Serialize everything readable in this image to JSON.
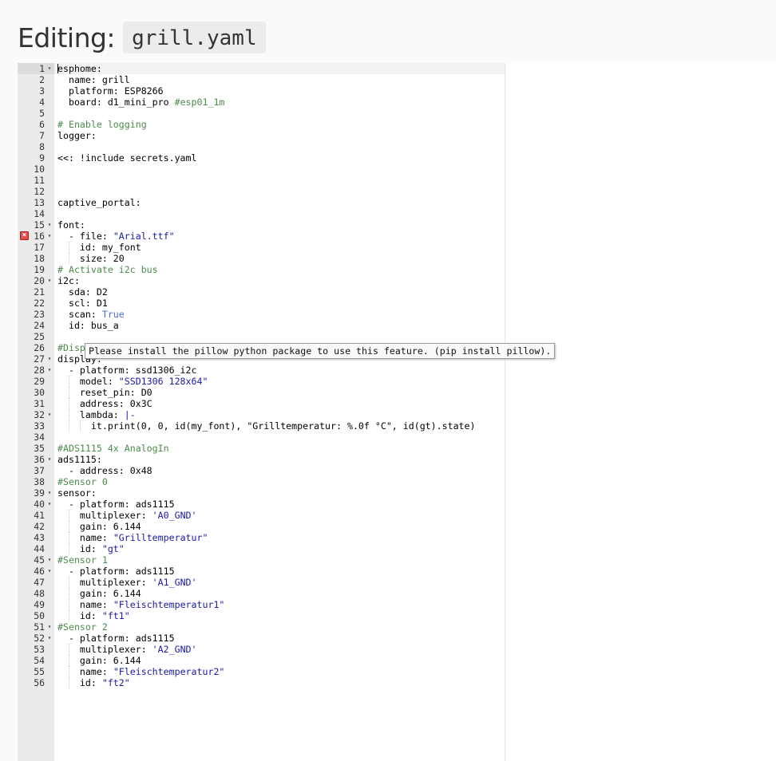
{
  "header": {
    "label": "Editing:",
    "filename": "grill.yaml"
  },
  "tooltip": "Please install the pillow python package to use this feature. (pip install pillow).",
  "lines": [
    {
      "n": "1",
      "fold": true,
      "segs": [
        [
          "k",
          "esphome:"
        ]
      ]
    },
    {
      "n": "2",
      "segs": [
        [
          "k",
          "  name: grill"
        ]
      ]
    },
    {
      "n": "3",
      "segs": [
        [
          "k",
          "  platform: ESP8266"
        ]
      ]
    },
    {
      "n": "4",
      "segs": [
        [
          "k",
          "  board: d1_mini_pro "
        ],
        [
          "c",
          "#esp01_1m"
        ]
      ]
    },
    {
      "n": "5",
      "segs": []
    },
    {
      "n": "6",
      "segs": [
        [
          "c",
          "# Enable logging"
        ]
      ]
    },
    {
      "n": "7",
      "segs": [
        [
          "k",
          "logger:"
        ]
      ]
    },
    {
      "n": "8",
      "segs": []
    },
    {
      "n": "9",
      "segs": [
        [
          "k",
          "<<: !include secrets.yaml"
        ]
      ]
    },
    {
      "n": "10",
      "segs": []
    },
    {
      "n": "11",
      "segs": []
    },
    {
      "n": "12",
      "segs": []
    },
    {
      "n": "13",
      "segs": [
        [
          "k",
          "captive_portal:"
        ]
      ]
    },
    {
      "n": "14",
      "segs": []
    },
    {
      "n": "15",
      "fold": true,
      "segs": [
        [
          "k",
          "font:"
        ]
      ]
    },
    {
      "n": "16",
      "fold": true,
      "error": true,
      "segs": [
        [
          "k",
          "  - file: "
        ],
        [
          "s",
          "\"Arial.ttf\""
        ]
      ]
    },
    {
      "n": "17",
      "segs": [
        [
          "k",
          "    id: my_font"
        ]
      ]
    },
    {
      "n": "18",
      "segs": [
        [
          "k",
          "    size: 20"
        ]
      ]
    },
    {
      "n": "19",
      "segs": [
        [
          "c",
          "# Activate i2c bus"
        ]
      ]
    },
    {
      "n": "20",
      "fold": true,
      "segs": [
        [
          "k",
          "i2c:"
        ]
      ]
    },
    {
      "n": "21",
      "segs": [
        [
          "k",
          "  sda: D2"
        ]
      ]
    },
    {
      "n": "22",
      "segs": [
        [
          "k",
          "  scl: D1"
        ]
      ]
    },
    {
      "n": "23",
      "segs": [
        [
          "k",
          "  scan: "
        ],
        [
          "b",
          "True"
        ]
      ]
    },
    {
      "n": "24",
      "segs": [
        [
          "k",
          "  id: bus_a"
        ]
      ]
    },
    {
      "n": "25",
      "segs": []
    },
    {
      "n": "26",
      "segs": [
        [
          "c",
          "#Disp"
        ]
      ]
    },
    {
      "n": "27",
      "fold": true,
      "segs": [
        [
          "k",
          "display:"
        ]
      ]
    },
    {
      "n": "28",
      "fold": true,
      "segs": [
        [
          "k",
          "  - platform: ssd1306_i2c"
        ]
      ]
    },
    {
      "n": "29",
      "segs": [
        [
          "k",
          "    model: "
        ],
        [
          "s",
          "\"SSD1306 128x64\""
        ]
      ]
    },
    {
      "n": "30",
      "segs": [
        [
          "k",
          "    reset_pin: D0"
        ]
      ]
    },
    {
      "n": "31",
      "segs": [
        [
          "k",
          "    address: 0x3C"
        ]
      ]
    },
    {
      "n": "32",
      "fold": true,
      "segs": [
        [
          "k",
          "    lambda: "
        ],
        [
          "s",
          "|-"
        ]
      ]
    },
    {
      "n": "33",
      "segs": [
        [
          "k",
          "      it.print(0, 0, id(my_font), \"Grilltemperatur: %.0f °C\", id(gt).state)"
        ]
      ]
    },
    {
      "n": "34",
      "segs": []
    },
    {
      "n": "35",
      "segs": [
        [
          "c",
          "#ADS1115 4x AnalogIn"
        ]
      ]
    },
    {
      "n": "36",
      "fold": true,
      "segs": [
        [
          "k",
          "ads1115:"
        ]
      ]
    },
    {
      "n": "37",
      "segs": [
        [
          "k",
          "  - address: 0x48"
        ]
      ]
    },
    {
      "n": "38",
      "segs": [
        [
          "c",
          "#Sensor 0"
        ]
      ]
    },
    {
      "n": "39",
      "fold": true,
      "segs": [
        [
          "k",
          "sensor:"
        ]
      ]
    },
    {
      "n": "40",
      "fold": true,
      "segs": [
        [
          "k",
          "  - platform: ads1115"
        ]
      ]
    },
    {
      "n": "41",
      "segs": [
        [
          "k",
          "    multiplexer: "
        ],
        [
          "s",
          "'A0_GND'"
        ]
      ]
    },
    {
      "n": "42",
      "segs": [
        [
          "k",
          "    gain: 6.144"
        ]
      ]
    },
    {
      "n": "43",
      "segs": [
        [
          "k",
          "    name: "
        ],
        [
          "s",
          "\"Grilltemperatur\""
        ]
      ]
    },
    {
      "n": "44",
      "segs": [
        [
          "k",
          "    id: "
        ],
        [
          "s",
          "\"gt\""
        ]
      ]
    },
    {
      "n": "45",
      "fold": true,
      "segs": [
        [
          "c",
          "#Sensor 1"
        ]
      ]
    },
    {
      "n": "46",
      "fold": true,
      "segs": [
        [
          "k",
          "  - platform: ads1115"
        ]
      ]
    },
    {
      "n": "47",
      "segs": [
        [
          "k",
          "    multiplexer: "
        ],
        [
          "s",
          "'A1_GND'"
        ]
      ]
    },
    {
      "n": "48",
      "segs": [
        [
          "k",
          "    gain: 6.144"
        ]
      ]
    },
    {
      "n": "49",
      "segs": [
        [
          "k",
          "    name: "
        ],
        [
          "s",
          "\"Fleischtemperatur1\""
        ]
      ]
    },
    {
      "n": "50",
      "segs": [
        [
          "k",
          "    id: "
        ],
        [
          "s",
          "\"ft1\""
        ]
      ]
    },
    {
      "n": "51",
      "fold": true,
      "segs": [
        [
          "c",
          "#Sensor 2"
        ]
      ]
    },
    {
      "n": "52",
      "fold": true,
      "segs": [
        [
          "k",
          "  - platform: ads1115"
        ]
      ]
    },
    {
      "n": "53",
      "segs": [
        [
          "k",
          "    multiplexer: "
        ],
        [
          "s",
          "'A2_GND'"
        ]
      ]
    },
    {
      "n": "54",
      "segs": [
        [
          "k",
          "    gain: 6.144"
        ]
      ]
    },
    {
      "n": "55",
      "segs": [
        [
          "k",
          "    name: "
        ],
        [
          "s",
          "\"Fleischtemperatur2\""
        ]
      ]
    },
    {
      "n": "56",
      "segs": [
        [
          "k",
          "    id: "
        ],
        [
          "s",
          "\"ft2\""
        ]
      ]
    }
  ],
  "icons": {
    "fold": "fold-arrow-icon",
    "error": "error-x-icon"
  }
}
